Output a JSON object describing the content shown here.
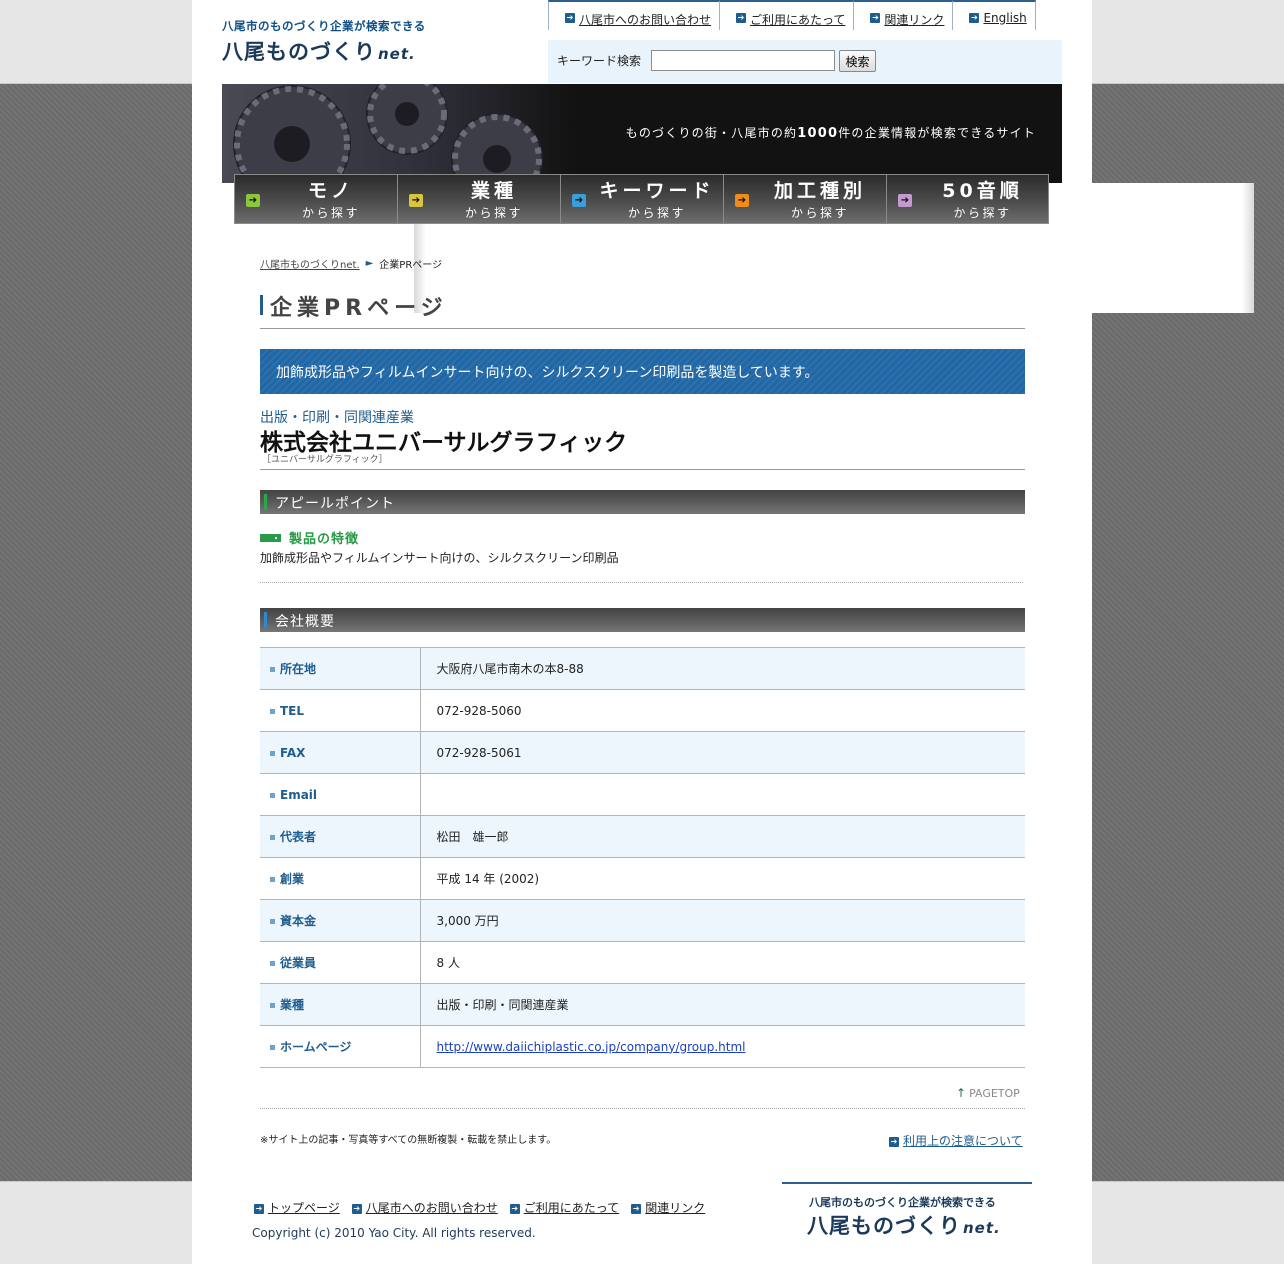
{
  "header": {
    "logo_tagline": "八尾市のものづくり企業が検索できる",
    "logo_main": "八尾ものづくり",
    "logo_net": "net.",
    "nav": [
      {
        "label": "八尾市へのお問い合わせ"
      },
      {
        "label": "ご利用にあたって"
      },
      {
        "label": "関連リンク"
      },
      {
        "label": "English"
      }
    ],
    "search": {
      "label": "キーワード検索",
      "value": "",
      "placeholder": "",
      "button": "検索"
    }
  },
  "hero": {
    "text_before": "ものづくりの街・八尾市の約",
    "text_number": "1000",
    "text_after": "件の企業情報が検索できるサイト"
  },
  "categories": [
    {
      "main": "モノ",
      "sub": "から探す",
      "color": "#8cc63f"
    },
    {
      "main": "業種",
      "sub": "から探す",
      "color": "#d8c640"
    },
    {
      "main": "キーワード",
      "sub": "から探す",
      "color": "#3a9fd8"
    },
    {
      "main": "加工種別",
      "sub": "から探す",
      "color": "#f08c1a"
    },
    {
      "main": "50音順",
      "sub": "から探す",
      "color": "#c59bcf"
    }
  ],
  "breadcrumb": {
    "home": "八尾市ものづくりnet.",
    "separator": "►",
    "current": "企業PRページ"
  },
  "page_title": "企業PRページ",
  "catchcopy": "加飾成形品やフィルムインサート向けの、シルクスクリーン印刷品を製造しています。",
  "company": {
    "industry": "出版・印刷・同関連産業",
    "name": "株式会社ユニバーサルグラフィック",
    "kana": "［ユニバーサルグラフィック］"
  },
  "appeal": {
    "heading": "アピールポイント",
    "feature_title": "製品の特徴",
    "feature_body": "加飾成形品やフィルムインサート向けの、シルクスクリーン印刷品"
  },
  "overview": {
    "heading": "会社概要",
    "rows": [
      {
        "key": "所在地",
        "value": "大阪府八尾市南木の本8-88"
      },
      {
        "key": "TEL",
        "value": "072-928-5060"
      },
      {
        "key": "FAX",
        "value": "072-928-5061"
      },
      {
        "key": "Email",
        "value": ""
      },
      {
        "key": "代表者",
        "value": "松田　雄一郎"
      },
      {
        "key": "創業",
        "value": "平成 14 年 (2002)"
      },
      {
        "key": "資本金",
        "value": "3,000 万円"
      },
      {
        "key": "従業員",
        "value": "8 人"
      },
      {
        "key": "業種",
        "value": "出版・印刷・同関連産業"
      },
      {
        "key": "ホームページ",
        "value": "http://www.daiichiplastic.co.jp/company/group.html"
      }
    ]
  },
  "pagetop": "PAGETOP",
  "notice": "※サイト上の記事・写真等すべての無断複製・転載を禁止します。",
  "terms_link": "利用上の注意について",
  "footer": {
    "nav": [
      {
        "label": "トップページ"
      },
      {
        "label": "八尾市へのお問い合わせ"
      },
      {
        "label": "ご利用にあたって"
      },
      {
        "label": "関連リンク"
      }
    ],
    "copyright": "Copyright (c) 2010 Yao City. All rights reserved.",
    "logo_tagline": "八尾市のものづくり企業が検索できる",
    "logo_main": "八尾ものづくり",
    "logo_net": "net."
  }
}
